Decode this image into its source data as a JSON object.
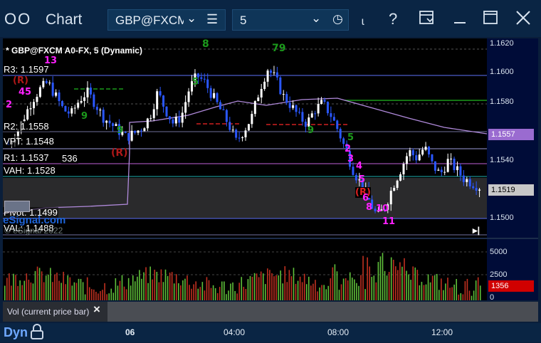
{
  "window": {
    "app_title": "Chart",
    "symbol": "GBP@FXCM",
    "interval": "5"
  },
  "chart": {
    "header": "* GBP@FXCM A0-FX, 5 (Dynamic)",
    "levels": {
      "r3": "R3: 1.1597",
      "r2": "R2: 1.1558",
      "vpt": "VPT: 1.1548",
      "r1": "R1: 1.1537",
      "r1_extra": "536",
      "vah": "VAH: 1.1528",
      "pivot": "Pivot: 1.1499",
      "val": "VAL: 1.1488"
    },
    "markers": {
      "r_top": "(R)",
      "r_mid": "(R)",
      "r_low": "(R)",
      "n13": "13",
      "n45": "45",
      "n2": "2",
      "n9a": "9",
      "n8": "8",
      "n79": "79",
      "n5": "5",
      "n5b": "5",
      "n2b": "2",
      "n3": "3",
      "n4": "4",
      "n5c": "5",
      "n6": "6",
      "n8b": "8",
      "n10": "10",
      "n11": "11",
      "n9_green": "9",
      "n5_green": "5"
    },
    "logo_text": "eSignal.com",
    "copyright": "© eSignal 2022",
    "chart_data": {
      "type": "candlestick",
      "symbol": "GBP@FXCM A0-FX",
      "interval": "5",
      "y_ticks": [
        "1.1620",
        "1.1600",
        "1.1580",
        "1.1557",
        "1.1540",
        "1.1519",
        "1.1500"
      ],
      "ylim": [
        1.1482,
        1.1627
      ],
      "last_price": "1.1519",
      "vwap_price": "1.1557",
      "close_path": [
        1.155,
        1.1558,
        1.157,
        1.1582,
        1.159,
        1.1595,
        1.1585,
        1.1575,
        1.1572,
        1.1582,
        1.1588,
        1.158,
        1.157,
        1.1565,
        1.156,
        1.1555,
        1.1558,
        1.1562,
        1.157,
        1.1588,
        1.1575,
        1.1565,
        1.157,
        1.159,
        1.16,
        1.1595,
        1.1585,
        1.1575,
        1.1565,
        1.1552,
        1.156,
        1.157,
        1.159,
        1.1605,
        1.1598,
        1.1585,
        1.1578,
        1.157,
        1.1565,
        1.1575,
        1.158,
        1.1572,
        1.156,
        1.1545,
        1.153,
        1.152,
        1.1508,
        1.1497,
        1.1505,
        1.152,
        1.1532,
        1.1545,
        1.154,
        1.1548,
        1.1535,
        1.1528,
        1.1538,
        1.1532,
        1.1525,
        1.1522,
        1.1519
      ]
    }
  },
  "price_axis": {
    "p1620": "1.1620",
    "p1600": "1.1600",
    "p1580": "1.1580",
    "p1557": "1.1557",
    "p1540": "1.1540",
    "p1519": "1.1519",
    "p1500": "1.1500"
  },
  "volume": {
    "study_label": "Vol (current price bar)",
    "axis": {
      "v5000": "5000",
      "v2500": "2500",
      "v0": "0",
      "current": "1356"
    },
    "chart_data": {
      "type": "bar",
      "current": 1356,
      "ylim": [
        0,
        6000
      ]
    }
  },
  "timebar": {
    "mode": "Dyn",
    "labels": {
      "t06": "06",
      "t0400": "04:00",
      "t0800": "08:00",
      "t1200": "12:00"
    }
  },
  "colors": {
    "up": "#ffffff",
    "down": "#2a57ff",
    "vwap": "#b08adb",
    "pivot_green": "#20c020",
    "pivot_red": "#e02020",
    "marker_magenta": "#ff20ff",
    "marker_green": "#1c9a1c"
  }
}
